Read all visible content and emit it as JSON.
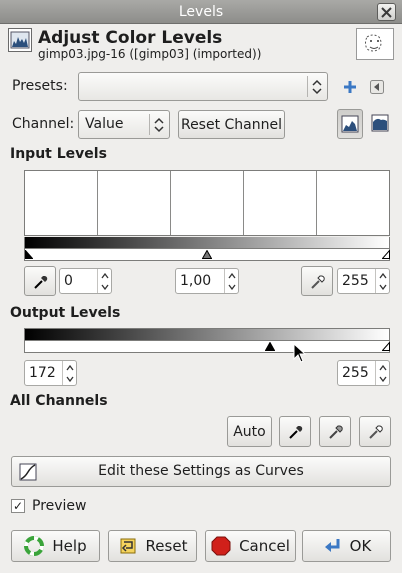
{
  "window": {
    "title": "Levels"
  },
  "header": {
    "title": "Adjust Color Levels",
    "subtitle": "gimp03.jpg-16 ([gimp03] (imported))"
  },
  "presets": {
    "label": "Presets:",
    "value": ""
  },
  "channel": {
    "label": "Channel:",
    "value": "Value",
    "reset_label": "Reset Channel"
  },
  "input_levels": {
    "heading": "Input Levels",
    "low": "0",
    "gamma": "1,00",
    "high": "255"
  },
  "output_levels": {
    "heading": "Output Levels",
    "low": "172",
    "high": "255"
  },
  "all_channels": {
    "heading": "All Channels",
    "auto_label": "Auto"
  },
  "curves_button": {
    "label": "Edit these Settings as Curves"
  },
  "preview": {
    "label": "Preview",
    "checked": true,
    "mark": "✓"
  },
  "footer": {
    "help": "Help",
    "reset": "Reset",
    "cancel": "Cancel",
    "ok": "OK"
  },
  "colors": {
    "accent": "#3b78c4",
    "cancel_red": "#d0201a",
    "help_green": "#3aa43a"
  }
}
